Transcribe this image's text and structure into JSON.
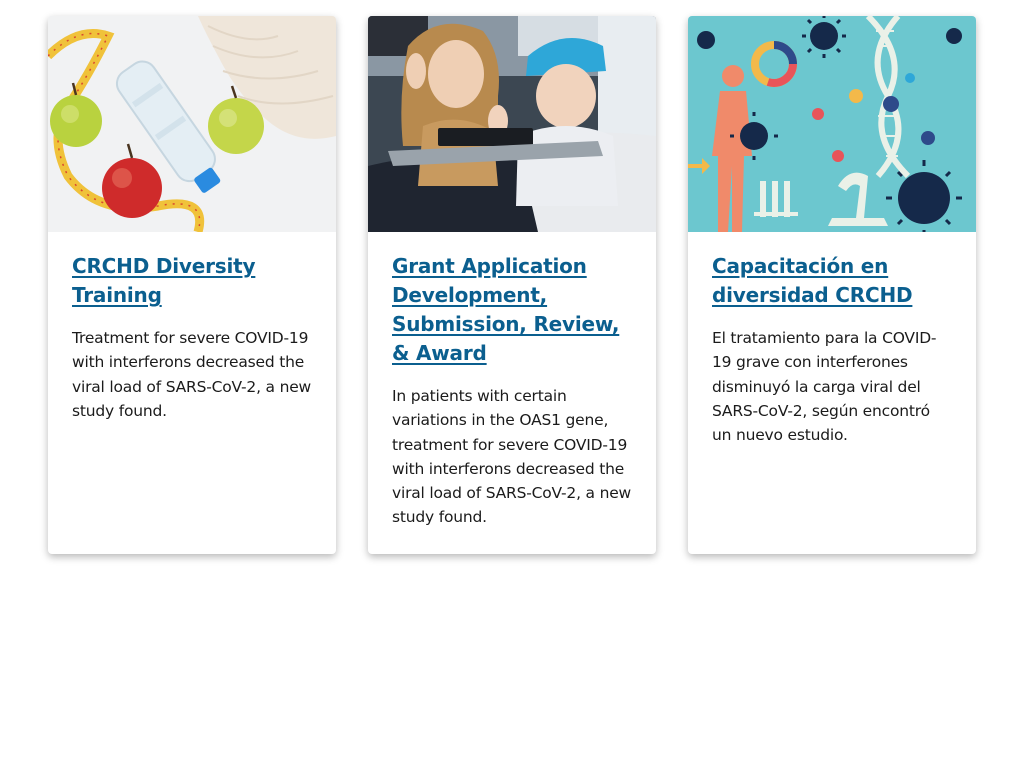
{
  "colors": {
    "link": "#0b5f8f",
    "body_text": "#1b1b1b",
    "card_background": "#ffffff"
  },
  "cards": [
    {
      "image_alt": "apples, water bottle, measuring tape and towel",
      "title": "CRCHD Diversity Training",
      "text": "Treatment for severe COVID-19 with interferons decreased the viral load of SARS-CoV-2, a new study found."
    },
    {
      "image_alt": "young patient and sister waving at a tablet",
      "title": "Grant Application Development, Submission, Review, & Award",
      "text": "In patients with certain variations in the OAS1 gene, treatment for severe COVID-19 with interferons decreased the viral load of SARS-CoV-2, a new study found."
    },
    {
      "image_alt": "science illustration with virus, DNA and human figure",
      "title": "Capacitación en diversidad CRCHD",
      "text": "El tratamiento para la COVID-19 grave con interferones disminuyó la carga viral del SARS-CoV-2, según encontró un nuevo estudio."
    }
  ]
}
